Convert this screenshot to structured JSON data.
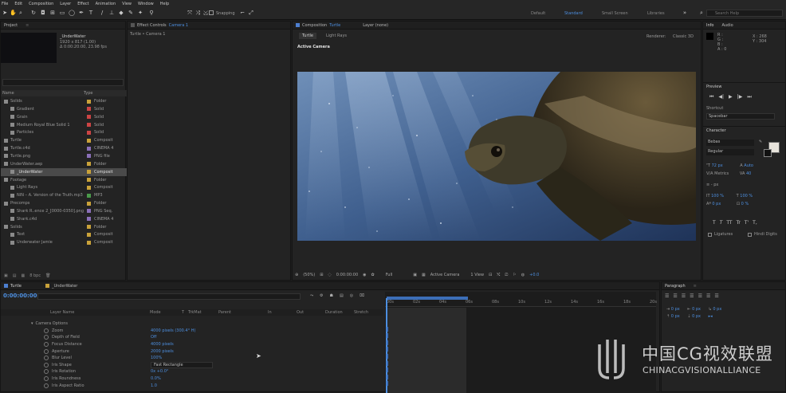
{
  "menu": [
    "File",
    "Edit",
    "Composition",
    "Layer",
    "Effect",
    "Animation",
    "View",
    "Window",
    "Help"
  ],
  "toolbar": {
    "snapping": "Snapping",
    "workspaces": [
      "Default",
      "Standard",
      "Small Screen",
      "Libraries"
    ],
    "search_placeholder": "Search Help"
  },
  "project": {
    "tab": "Project",
    "comp_name": "_UnderWater",
    "info1": "1920 x 817 (1.00)",
    "info2": "Δ 0:00:20:00, 23.98 fps",
    "col_name": "Name",
    "col_type": "Type",
    "bpc": "8 bpc",
    "items": [
      {
        "name": "Solids",
        "type": "Folder",
        "color": "#c9a23a"
      },
      {
        "name": "Gradient",
        "type": "Solid",
        "color": "#c44"
      },
      {
        "name": "Grain",
        "type": "Solid",
        "color": "#c44"
      },
      {
        "name": "Medium Royal Blue Solid 1",
        "type": "Solid",
        "color": "#c44"
      },
      {
        "name": "Particles",
        "type": "Solid",
        "color": "#c44"
      },
      {
        "name": "Turtle",
        "type": "Composit",
        "color": "#c9a23a"
      },
      {
        "name": "Turtle.c4d",
        "type": "CINEMA 4",
        "color": "#8a6fb8"
      },
      {
        "name": "Turtle.png",
        "type": "PNG file",
        "color": "#8a6fb8"
      },
      {
        "name": "UnderWater.aep",
        "type": "Folder",
        "color": "#c9a23a"
      },
      {
        "name": "_UnderWater",
        "type": "Composit",
        "color": "#c9a23a"
      },
      {
        "name": "Footage",
        "type": "Folder",
        "color": "#c9a23a"
      },
      {
        "name": "Light Rays",
        "type": "Composit",
        "color": "#c9a23a"
      },
      {
        "name": "NIN – A. Version of the Truth.mp3",
        "type": "MP3",
        "color": "#4a9a4a"
      },
      {
        "name": "Precomps",
        "type": "Folder",
        "color": "#c9a23a"
      },
      {
        "name": "Shark R..ence 2_[0000-0350].png",
        "type": "PNG Seq.",
        "color": "#8a6fb8"
      },
      {
        "name": "Shark.c4d",
        "type": "CINEMA 4",
        "color": "#8a6fb8"
      },
      {
        "name": "Solids",
        "type": "Folder",
        "color": "#c9a23a"
      },
      {
        "name": "Text",
        "type": "Composit",
        "color": "#c9a23a"
      },
      {
        "name": "Underwater Jamie",
        "type": "Composit",
        "color": "#c9a23a"
      }
    ]
  },
  "effect": {
    "tab": "Effect Controls",
    "tab_highlight": "Camera 1",
    "subtitle": "Turtle • Camera 1"
  },
  "comp": {
    "tab": "Composition",
    "tab_highlight": "Turtle",
    "layer_tab": "Layer (none)",
    "sub_tabs": [
      "Turtle",
      "Light Rays"
    ],
    "renderer": "Renderer:",
    "renderer_val": "Classic 3D",
    "view_label": "Active Camera",
    "footer": {
      "zoom": "(50%)",
      "timecode": "0:00:00:00",
      "res": "Full",
      "camera": "Active Camera",
      "views": "1 View",
      "offset": "+0.0"
    }
  },
  "info": {
    "tab": "Info",
    "audio": "Audio",
    "channels": [
      "R :",
      "G :",
      "B :",
      "A : 0"
    ],
    "x": "X : 268",
    "y": "Y : 304"
  },
  "preview": {
    "tab": "Preview"
  },
  "shortcut": {
    "label": "Shortcut",
    "value": "Spacebar"
  },
  "character": {
    "tab": "Character",
    "font": "Bebas",
    "style": "Regular",
    "size": "72 px",
    "leading": "Auto",
    "tracking": "40",
    "metrics": "Metrics",
    "stroke": "- px",
    "vscale": "100 %",
    "hscale": "100 %",
    "baseline": "0 px",
    "tsume": "0 %",
    "styles": [
      "T",
      "T",
      "TT",
      "Tr",
      "T'",
      "T,"
    ],
    "ligatures": "Ligatures",
    "hindi": "Hindi Digits"
  },
  "paragraph": {
    "tab": "Paragraph",
    "px": [
      "0 px",
      "0 px",
      "0 px",
      "0 px",
      "0 px"
    ]
  },
  "timeline": {
    "tabs": [
      "Turtle",
      "_UnderWater"
    ],
    "timecode": "0:00:00:00",
    "cols": [
      "Layer Name",
      "Mode",
      "T",
      "TrkMat",
      "Parent",
      "In",
      "Out",
      "Duration",
      "Stretch"
    ],
    "ruler": [
      "00s",
      "02s",
      "04s",
      "06s",
      "08s",
      "10s",
      "12s",
      "14s",
      "16s",
      "18s",
      "20s"
    ],
    "props": [
      {
        "name": "Camera Options",
        "value": "",
        "group": true
      },
      {
        "name": "Zoom",
        "value": "4000 pixels (300.4° H)"
      },
      {
        "name": "Depth of Field",
        "value": "Off"
      },
      {
        "name": "Focus Distance",
        "value": "4000 pixels"
      },
      {
        "name": "Aperture",
        "value": "2000 pixels"
      },
      {
        "name": "Blur Level",
        "value": "100%"
      },
      {
        "name": "Iris Shape",
        "value": "Fast Rectangle"
      },
      {
        "name": "Iris Rotation",
        "value": "0x +0.0°"
      },
      {
        "name": "Iris Roundness",
        "value": "0.0%"
      },
      {
        "name": "Iris Aspect Ratio",
        "value": "1.0"
      }
    ]
  },
  "watermark": {
    "cn": "中国CG视效联盟",
    "en": "CHINACGVISIONALLIANCE"
  },
  "colors": {
    "accent": "#4d8fe0",
    "panel": "#232323",
    "bg": "#1d1d1d"
  }
}
